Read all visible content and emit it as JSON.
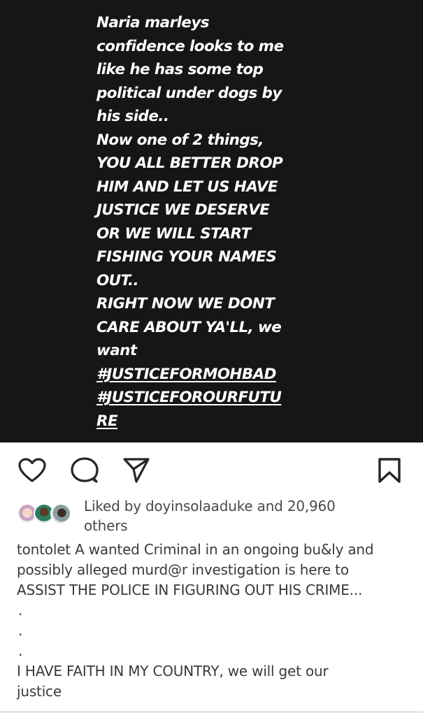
{
  "story": {
    "lines": [
      "Naria marleys",
      "confidence looks to me",
      "like he has some top",
      "political under dogs by",
      "his side..",
      "Now one of 2 things,",
      "YOU ALL BETTER DROP",
      "HIM AND LET US HAVE",
      "JUSTICE WE DESERVE",
      "OR WE WILL START",
      "FISHING YOUR NAMES",
      "OUT..",
      "RIGHT NOW WE DONT",
      "CARE ABOUT YA'LL, we",
      "want"
    ],
    "hashtags": [
      "#JUSTICEFORMOHBAD",
      "#JUSTICEFOROURFUTU",
      "RE"
    ]
  },
  "actions": {
    "like_icon": "heart-icon",
    "comment_icon": "comment-icon",
    "share_icon": "send-icon",
    "save_icon": "bookmark-icon"
  },
  "likes": {
    "line1": "Liked by doyinsolaaduke and 20,960",
    "line2": "others"
  },
  "caption": {
    "lines": [
      "tontolet A wanted Criminal in an ongoing bu&ly and",
      "possibly alleged murd@r investigation is here to",
      "ASSIST THE POLICE IN FIGURING OUT HIS CRIME..."
    ],
    "dots": [
      ".",
      ".",
      "."
    ],
    "closing": [
      "I HAVE FAITH IN MY COUNTRY, we will get our",
      "justice"
    ]
  },
  "colors": {
    "story_bg": "#161616",
    "story_text": "#ffffff",
    "icon": "#262626"
  }
}
